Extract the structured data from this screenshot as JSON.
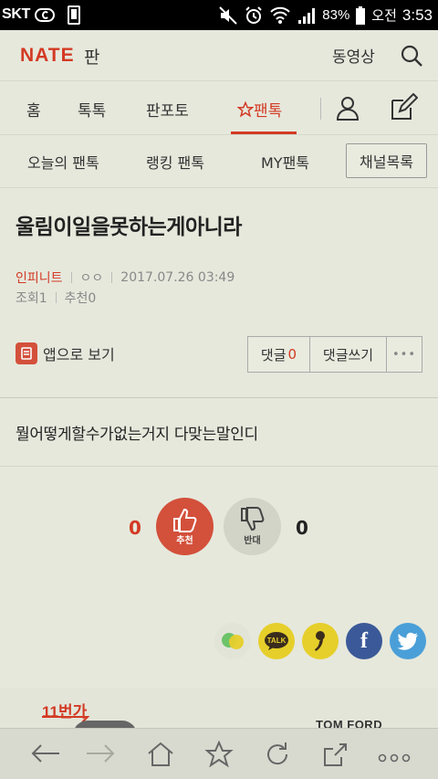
{
  "status_bar": {
    "carrier": "SKT",
    "battery": "83%",
    "ampm": "오전",
    "time": "3:53"
  },
  "header": {
    "logo": "NATE",
    "logo_sub": "판",
    "video_link": "동영상",
    "search_icon": "search-icon"
  },
  "tabs": {
    "items": [
      "홈",
      "톡톡",
      "판포토",
      "팬톡"
    ],
    "active": "팬톡",
    "user_icon": "user-icon",
    "write_icon": "pencil-icon"
  },
  "subtabs": {
    "items": [
      "오늘의 팬톡",
      "랭킹 팬톡",
      "MY팬톡"
    ],
    "channel_button": "채널목록"
  },
  "article": {
    "title": "울림이일을못하는게아니라",
    "author": "인피니트",
    "nickname": "ㅇㅇ",
    "datetime": "2017.07.26 03:49",
    "views": "조회1",
    "recommends": "추천0",
    "app_view": "앱으로 보기",
    "comment_label": "댓글",
    "comment_count": "0",
    "write_comment": "댓글쓰기",
    "more": "•••",
    "body": "뭘어떻게할수가없는거지 다맞는말인디"
  },
  "vote": {
    "up_count": "0",
    "up_label": "추천",
    "down_label": "반대",
    "down_count": "0"
  },
  "share": {
    "icons": [
      "line-icon",
      "kakaotalk-icon",
      "kakaostory-icon",
      "facebook-icon",
      "twitter-icon"
    ],
    "talk_text": "TALK",
    "fb_text": "f"
  },
  "ad": {
    "logo": "11번가",
    "brand": "TOM FORD"
  },
  "colors": {
    "accent": "#d33a24",
    "background": "#e6e8dc"
  }
}
